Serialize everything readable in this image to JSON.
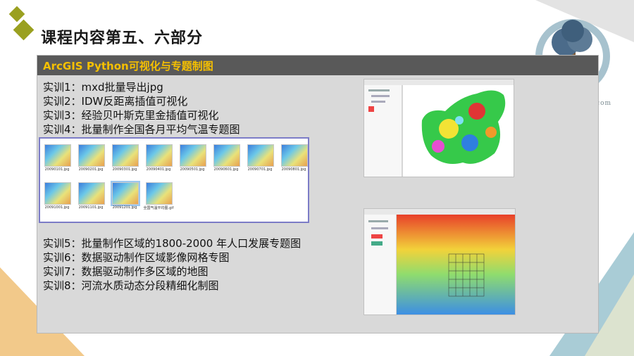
{
  "title": "课程内容第五、六部分",
  "panel": {
    "header": "ArcGIS Python可视化与专题制图",
    "items_top": [
      "实训1：mxd批量导出jpg",
      "实训2：IDW反距离插值可视化",
      "实训3：经验贝叶斯克里金插值可视化",
      "实训4：批量制作全国各月平均气温专题图"
    ],
    "items_bottom": [
      "实训5：批量制作区域的1800-2000 年人口发展专题图",
      "实训6：数据驱动制作区域影像网格专图",
      "实训7：数据驱动制作多区域的地图",
      "实训8：河流水质动态分段精细化制图"
    ],
    "thumbnails": [
      "20090101.jpg",
      "20090201.jpg",
      "20090301.jpg",
      "20090401.jpg",
      "20090501.jpg",
      "20090601.jpg",
      "20090701.jpg",
      "20090801.jpg",
      "20091001.jpg",
      "20091101.jpg",
      "20091201.jpg",
      "全国气温平均图.gif"
    ]
  },
  "watermark": "www.bjsgxxkj.com",
  "colors": {
    "accent": "#9aa020",
    "header_bg": "#595959",
    "header_text": "#f6c000",
    "panel_bg": "#d9d9d9"
  }
}
